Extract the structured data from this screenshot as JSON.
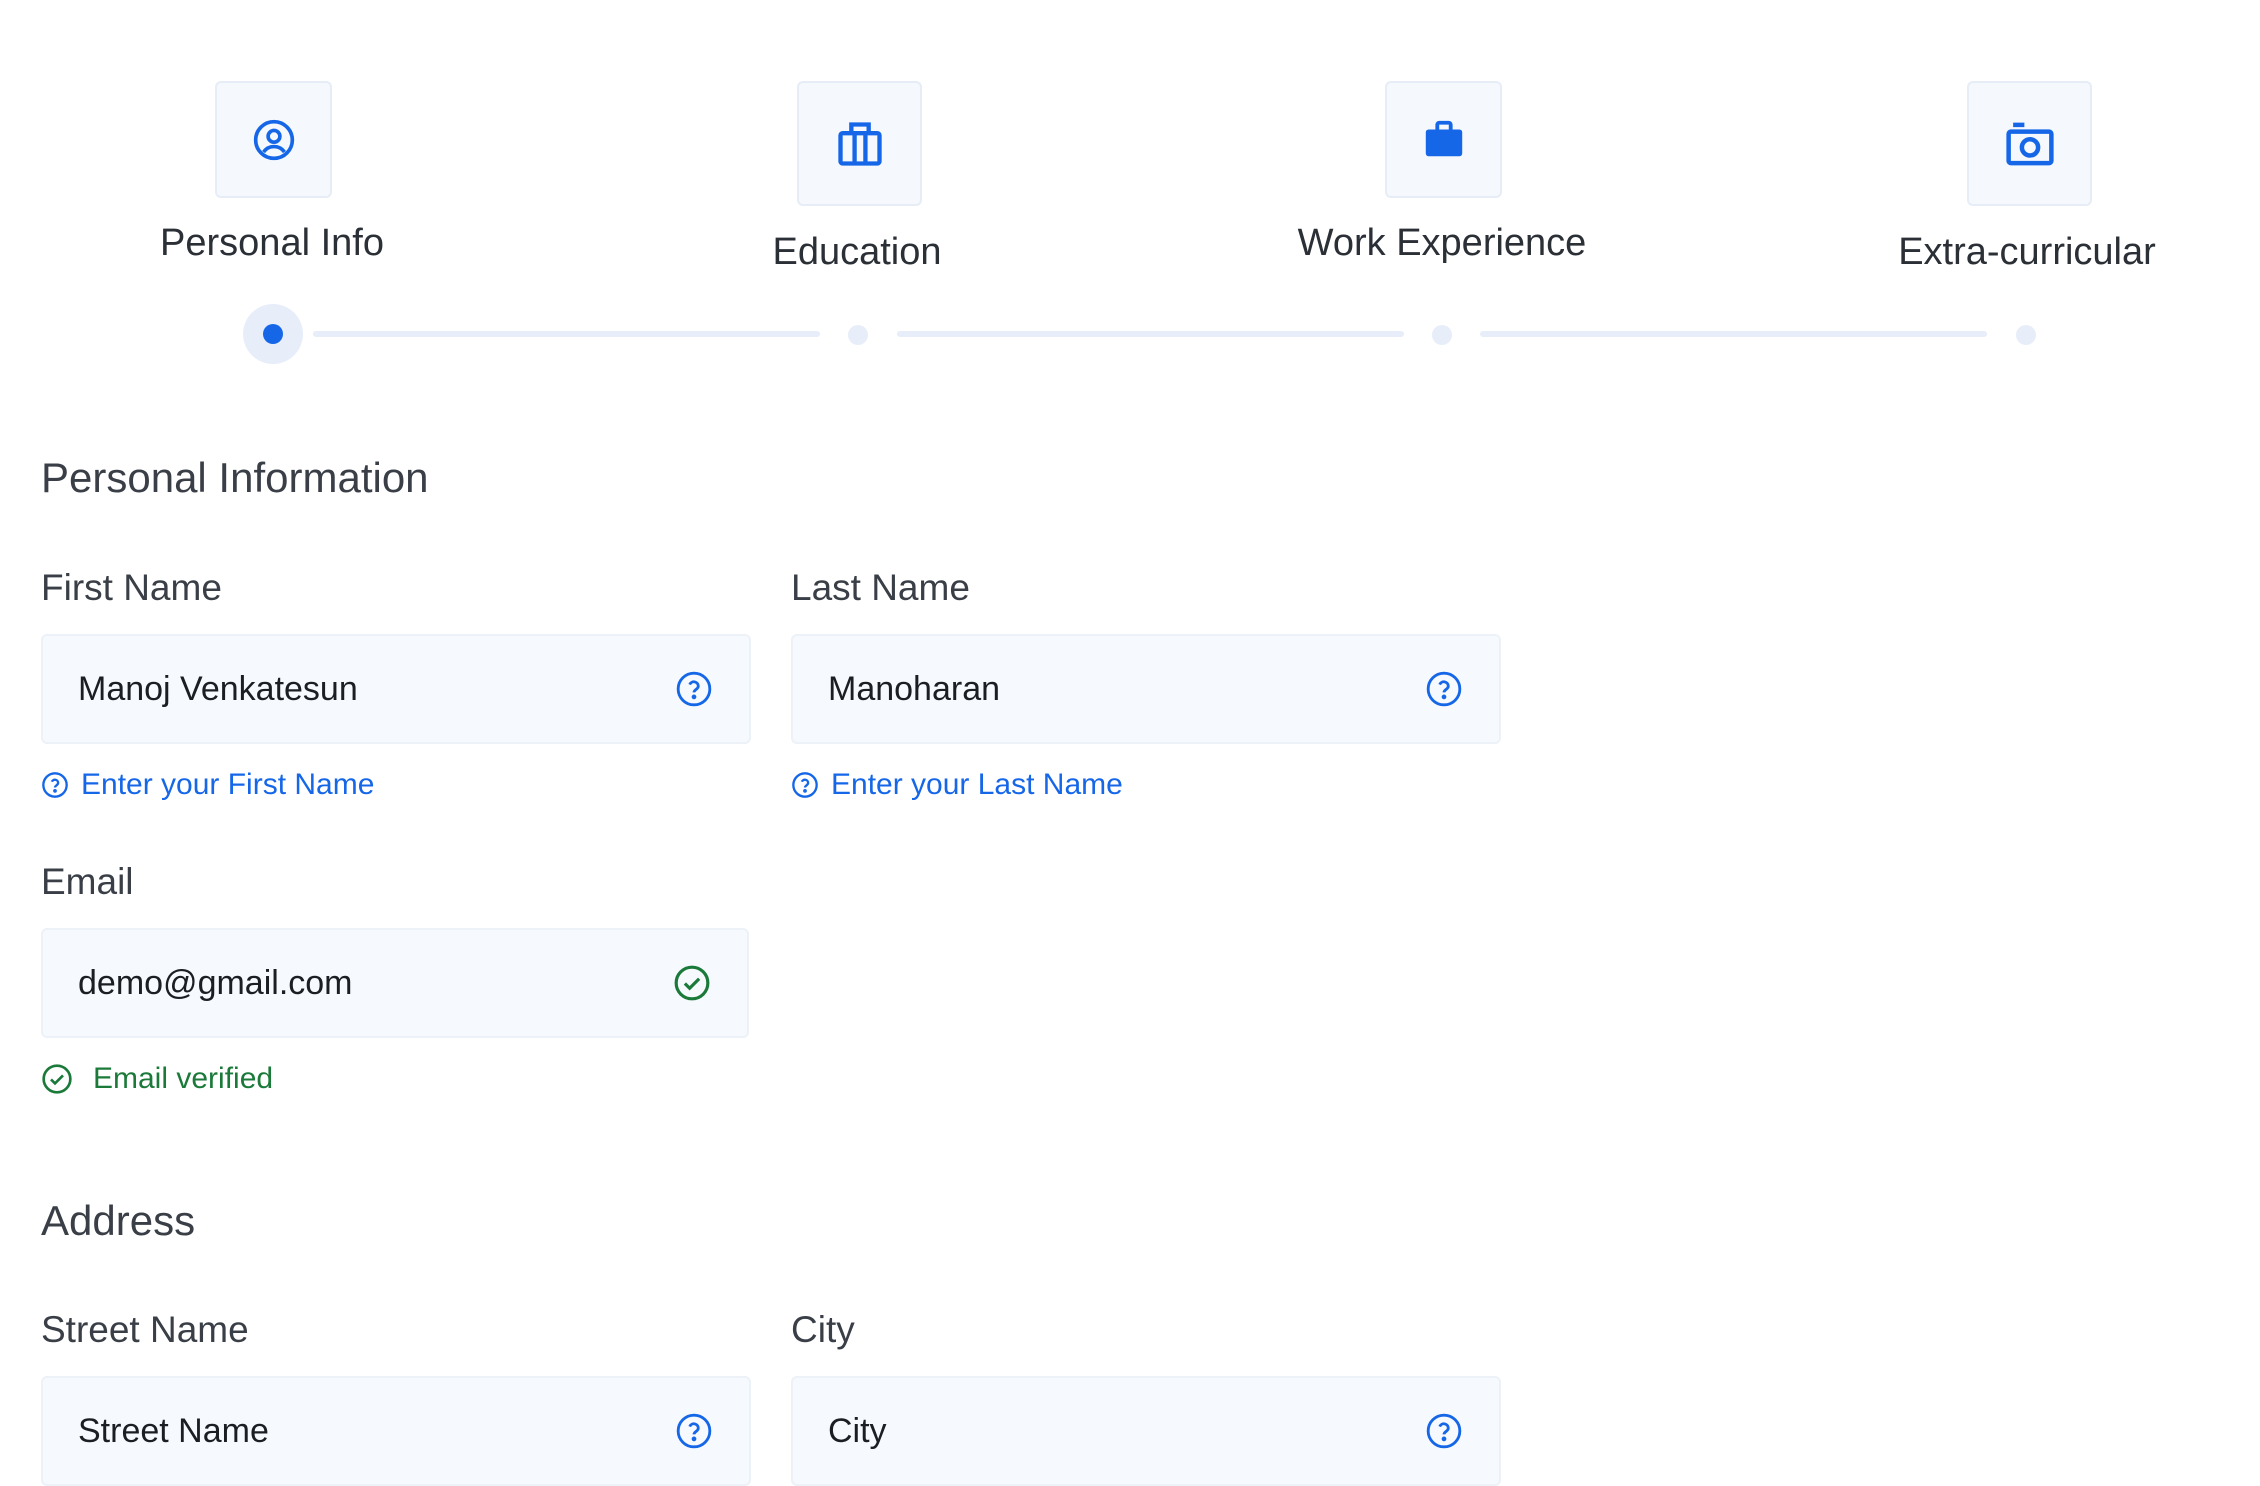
{
  "colors": {
    "accent": "#1667e8",
    "success": "#1b7a3a",
    "track": "#e7eefa",
    "input_bg": "#f6f9fd"
  },
  "stepper": {
    "steps": [
      {
        "label": "Personal Info",
        "icon": "user-circle-icon",
        "active": true
      },
      {
        "label": "Education",
        "icon": "building-icon",
        "active": false
      },
      {
        "label": "Work Experience",
        "icon": "briefcase-icon",
        "active": false
      },
      {
        "label": "Extra-curricular",
        "icon": "camera-icon",
        "active": false
      }
    ]
  },
  "personal": {
    "title": "Personal Information",
    "first_name": {
      "label": "First Name",
      "value": "Manoj Venkatesun",
      "helper": "Enter your First Name",
      "icon": "help-circle-icon"
    },
    "last_name": {
      "label": "Last Name",
      "value": "Manoharan",
      "helper": "Enter your Last Name",
      "icon": "help-circle-icon"
    },
    "email": {
      "label": "Email",
      "value": "demo@gmail.com",
      "helper": "Email verified",
      "icon": "check-circle-icon"
    }
  },
  "address": {
    "title": "Address",
    "street": {
      "label": "Street Name",
      "placeholder": "Street Name",
      "icon": "help-circle-icon"
    },
    "city": {
      "label": "City",
      "placeholder": "City",
      "icon": "help-circle-icon"
    }
  }
}
